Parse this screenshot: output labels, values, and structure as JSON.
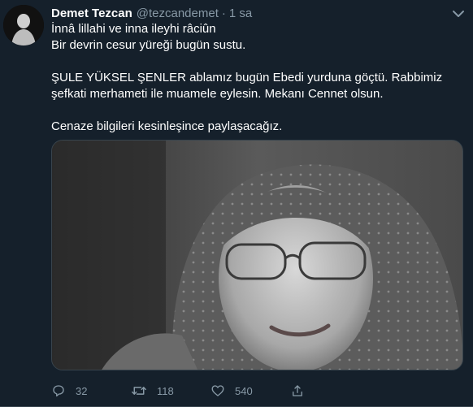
{
  "tweet": {
    "author": {
      "display_name": "Demet Tezcan",
      "handle": "@tezcandemet",
      "separator": "·",
      "time": "1 sa"
    },
    "lines": [
      "İnnâ lillahi ve inna ileyhi râciûn",
      "Bir devrin cesur yüreği bugün sustu.",
      "ŞULE YÜKSEL ŞENLER ablamız bugün Ebedi yurduna göçtü. Rabbimiz şefkati merhameti ile muamele eylesin. Mekanı Cennet olsun.",
      "Cenaze bilgileri kesinleşince paylaşacağız."
    ],
    "actions": {
      "reply_count": "32",
      "retweet_count": "118",
      "like_count": "540"
    }
  },
  "colors": {
    "background": "#15202b",
    "secondary_text": "#8899a6",
    "border": "#38444d"
  },
  "icons": [
    "caret-down-icon",
    "reply-icon",
    "retweet-icon",
    "like-icon",
    "share-icon"
  ]
}
